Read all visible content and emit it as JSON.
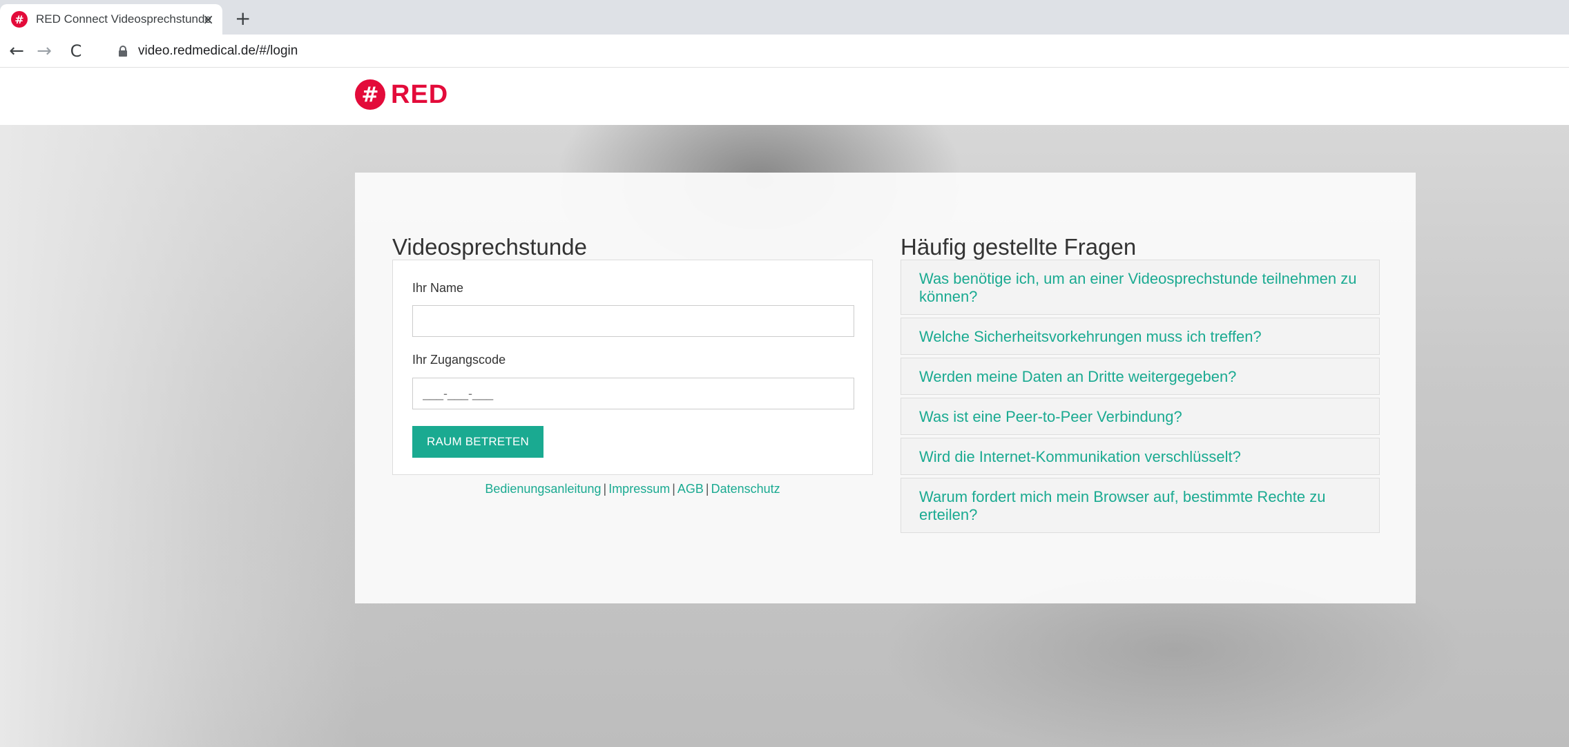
{
  "browser": {
    "tab_title": "RED Connect Videosprechstunde",
    "tab_close": "×",
    "new_tab": "+",
    "url": "video.redmedical.de/#/login"
  },
  "header": {
    "logo_text": "RED",
    "logo_mark": "#"
  },
  "login": {
    "title": "Videosprechstunde",
    "name_label": "Ihr Name",
    "name_value": "",
    "code_label": "Ihr Zugangscode",
    "code_placeholder": "___-___-___",
    "submit_label": "RAUM BETRETEN"
  },
  "footer_links": [
    "Bedienungsanleitung",
    "Impressum",
    "AGB",
    "Datenschutz"
  ],
  "footer_separator": "|",
  "faq": {
    "title": "Häufig gestellte Fragen",
    "items": [
      "Was benötige ich, um an einer Videosprechstunde teilnehmen zu können?",
      "Welche Sicherheitsvorkehrungen muss ich treffen?",
      "Werden meine Daten an Dritte weitergegeben?",
      "Was ist eine Peer-to-Peer Verbindung?",
      "Wird die Internet-Kommunikation verschlüsselt?",
      "Warum fordert mich mein Browser auf, bestimmte Rechte zu erteilen?"
    ]
  },
  "colors": {
    "brand": "#e30b3a",
    "accent": "#1aaa91"
  },
  "icons": {
    "favicon": "red-hash-icon",
    "back": "arrow-left-icon",
    "forward": "arrow-right-icon",
    "reload": "reload-icon",
    "lock": "lock-icon"
  }
}
